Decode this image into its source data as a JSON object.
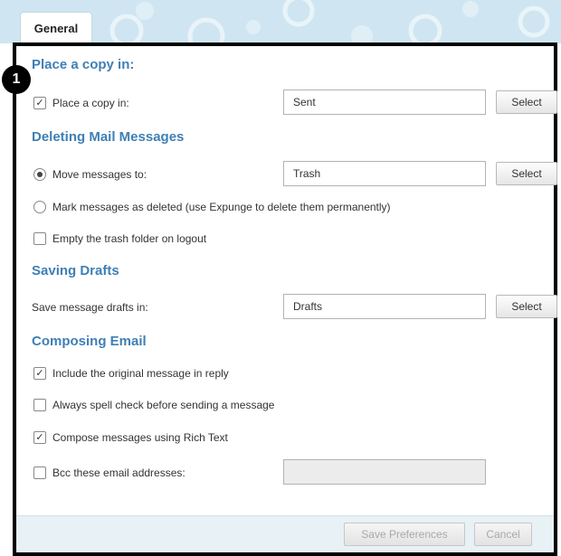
{
  "tab": {
    "label": "General"
  },
  "step_badge": "1",
  "sections": {
    "copy": {
      "title": "Place a copy in:",
      "checkbox_label": "Place a copy in:",
      "checked": true,
      "field_value": "Sent",
      "select_label": "Select"
    },
    "deleting": {
      "title": "Deleting Mail Messages",
      "move_label": "Move messages to:",
      "move_selected": true,
      "move_field_value": "Trash",
      "select_label": "Select",
      "mark_label": "Mark messages as deleted (use Expunge to delete them permanently)",
      "empty_label": "Empty the trash folder on logout",
      "empty_checked": false
    },
    "drafts": {
      "title": "Saving Drafts",
      "label": "Save message drafts in:",
      "field_value": "Drafts",
      "select_label": "Select"
    },
    "composing": {
      "title": "Composing Email",
      "include_label": "Include the original message in reply",
      "include_checked": true,
      "spell_label": "Always spell check before sending a message",
      "spell_checked": false,
      "rich_label": "Compose messages using Rich Text",
      "rich_checked": true,
      "bcc_label": "Bcc these email addresses:",
      "bcc_checked": false,
      "bcc_value": ""
    }
  },
  "footer": {
    "save_label": "Save Preferences",
    "cancel_label": "Cancel"
  },
  "icons": {
    "check": "✓"
  },
  "colors": {
    "section_title": "#3f7fb5",
    "header_bg": "#cfe6f2",
    "footer_bg": "#e8f1f6"
  }
}
